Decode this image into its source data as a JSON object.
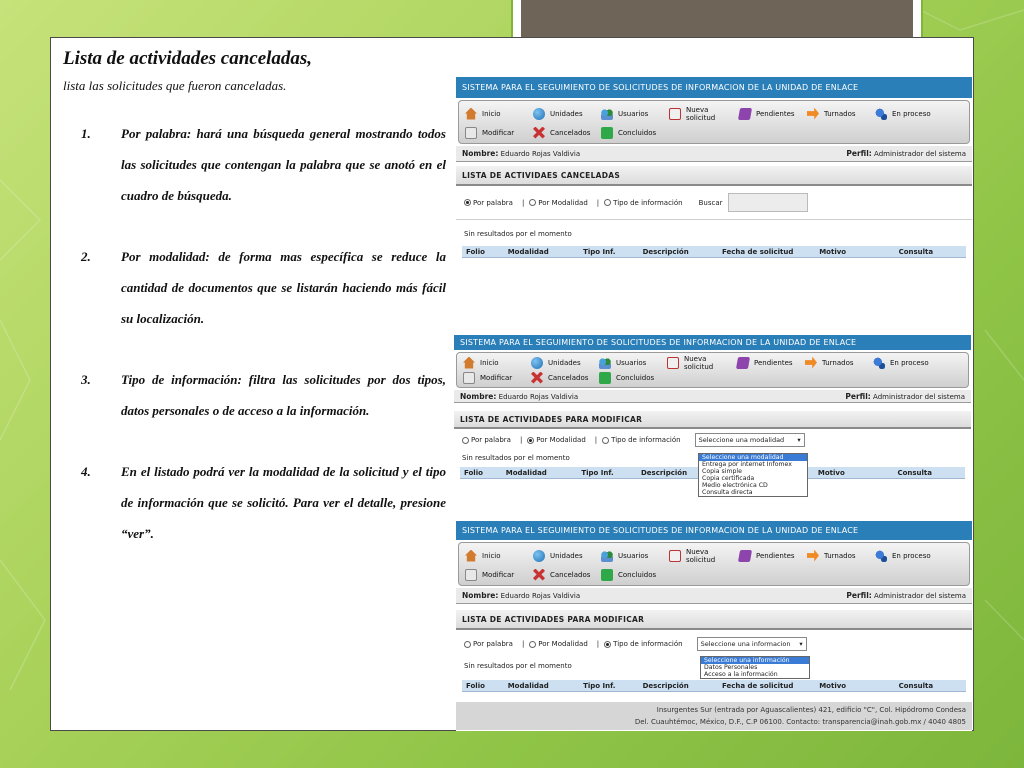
{
  "slide": {
    "heading": "Lista de actividades canceladas,",
    "subheading": "lista las solicitudes que fueron canceladas.",
    "items": [
      {
        "num": "1.",
        "text": "Por palabra: hará una búsqueda general mostrando todos las solicitudes que contengan la palabra que se anotó en el cuadro de búsqueda."
      },
      {
        "num": "2.",
        "text": "Por modalidad: de forma mas específica se reduce la cantidad de documentos que se listarán haciendo más fácil su localización."
      },
      {
        "num": "3.",
        "text": "Tipo de información: filtra las solicitudes por dos tipos, datos personales o de acceso a la información."
      },
      {
        "num": "4.",
        "text": "En el listado podrá ver la modalidad de la solicitud y el tipo de información que se solicitó. Para ver el detalle, presione “ver”."
      }
    ]
  },
  "app": {
    "title": "SISTEMA PARA EL SEGUIMIENTO DE SOLICITUDES DE INFORMACION DE LA UNIDAD DE ENLACE",
    "menu": [
      {
        "label": "Inicio",
        "icon": "home-icon"
      },
      {
        "label": "Unidades",
        "icon": "globe-icon"
      },
      {
        "label": "Usuarios",
        "icon": "users-icon"
      },
      {
        "label": "Nueva solicitud",
        "icon": "new-request-icon"
      },
      {
        "label": "Pendientes",
        "icon": "pending-icon"
      },
      {
        "label": "Turnados",
        "icon": "forward-arrow-icon"
      },
      {
        "label": "En proceso",
        "icon": "process-icon"
      },
      {
        "label": "Modificar",
        "icon": "edit-icon"
      },
      {
        "label": "Cancelados",
        "icon": "cancel-icon"
      },
      {
        "label": "Concluidos",
        "icon": "check-icon"
      }
    ],
    "user_label": "Nombre:",
    "user_name": "Eduardo Rojas Valdivia",
    "profile_label": "Perfil:",
    "profile_value": "Administrador del sistema",
    "options": {
      "word": "Por palabra",
      "mode": "Por Modalidad",
      "type": "Tipo de información",
      "sep": "|"
    },
    "search_label": "Buscar",
    "no_results": "Sin resultados por el momento",
    "columns": [
      "Folio",
      "Modalidad",
      "Tipo Inf.",
      "Descripción",
      "Fecha de solicitud",
      "Motivo",
      "Consulta"
    ]
  },
  "screen1": {
    "section": "LISTA DE ACTIVIDAES CANCELADAS"
  },
  "screen2": {
    "section": "LISTA DE ACTIVIDADES PARA MODIFICAR",
    "select_value": "Seleccione una modalidad",
    "dropdown": [
      "Seleccione una modalidad",
      "Entrega por internet Infomex",
      "Copia simple",
      "Copia certificada",
      "Medio electrónica CD",
      "Consulta directa"
    ]
  },
  "screen3": {
    "section": "LISTA DE ACTIVIDADES PARA MODIFICAR",
    "select_value": "Seleccione una informacion",
    "dropdown": [
      "Seleccione una información",
      "Datos Personales",
      "Acceso a la información"
    ],
    "footer_line1": "Insurgentes Sur (entrada por Aguascalientes) 421, edificio \"C\", Col. Hipódromo Condesa",
    "footer_line2": "Del. Cuauhtémoc, México, D.F., C.P 06100. Contacto: transparencia@inah.gob.mx / 4040 4805"
  }
}
